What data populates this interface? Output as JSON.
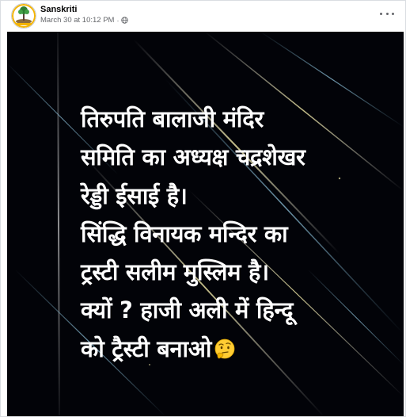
{
  "post": {
    "author": "Sanskriti",
    "timestamp": "March 30 at 10:12 PM",
    "separator": "·",
    "privacy_icon": "globe-icon",
    "more_icon": "more-options-icon",
    "avatar": {
      "logo_text": "SANSKRITI",
      "colors": {
        "ring": "#f4b400",
        "tree": "#2e7d32",
        "earth": "#8d6e3f"
      }
    }
  },
  "image": {
    "background": "#000000",
    "text_color": "#ffffff",
    "lines": [
      "तिरुपति बालाजी मंदिर",
      "समिति का अध्यक्ष चद्रशेखर",
      "रेड्डी ईसाई है।",
      "सिंद्धि विनायक मन्दिर का",
      "ट्रस्टी सलीम मुस्लिम है।",
      "क्यों ? हाजी अली में हिन्दू",
      "को ट्रैस्टी बनाओ"
    ],
    "emoji": "thinking-face-icon"
  }
}
